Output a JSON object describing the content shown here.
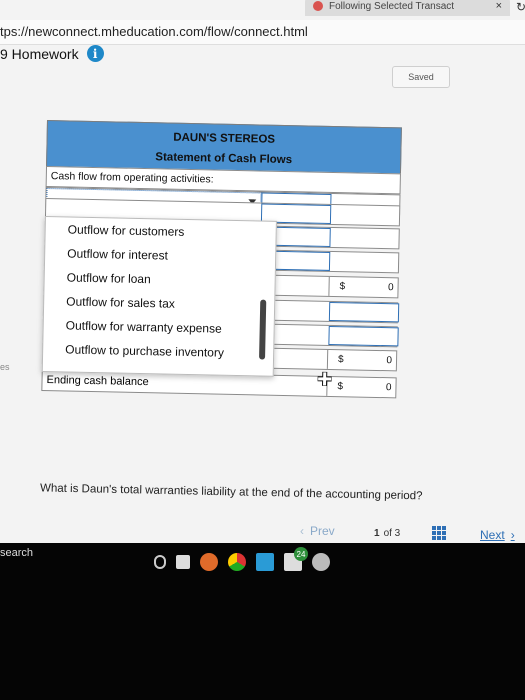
{
  "browser": {
    "tab_title": "Following Selected Transact",
    "close_symbol": "×",
    "url": "tps://newconnect.mheducation.com/flow/connect.html"
  },
  "assignment": {
    "title": "9 Homework",
    "info_glyph": "i",
    "saved_label": "Saved"
  },
  "statement": {
    "company": "DAUN'S STEREOS",
    "title": "Statement of Cash Flows",
    "section_label": "Cash flow from operating activities:",
    "dropdown_options": [
      "Outflow for customers",
      "Outflow for interest",
      "Outflow for loan",
      "Outflow for sales tax",
      "Outflow for warranty expense",
      "Outflow to purchase inventory"
    ],
    "currency": "$",
    "subtotal_1": "0",
    "subtotal_2": "0",
    "ending_label": "Ending cash balance",
    "ending_value": "0"
  },
  "side_fragment": "es",
  "question": "What is Daun's total warranties liability at the end of the accounting period?",
  "pager": {
    "prev": "Prev",
    "current": "1",
    "of_label": "of 3",
    "next": "Next"
  },
  "taskbar": {
    "search_fragment": "search",
    "mail_badge": "24"
  },
  "colors": {
    "header_blue": "#4a90cf",
    "input_border": "#2e6fb5",
    "info_blue": "#1e88c8"
  }
}
